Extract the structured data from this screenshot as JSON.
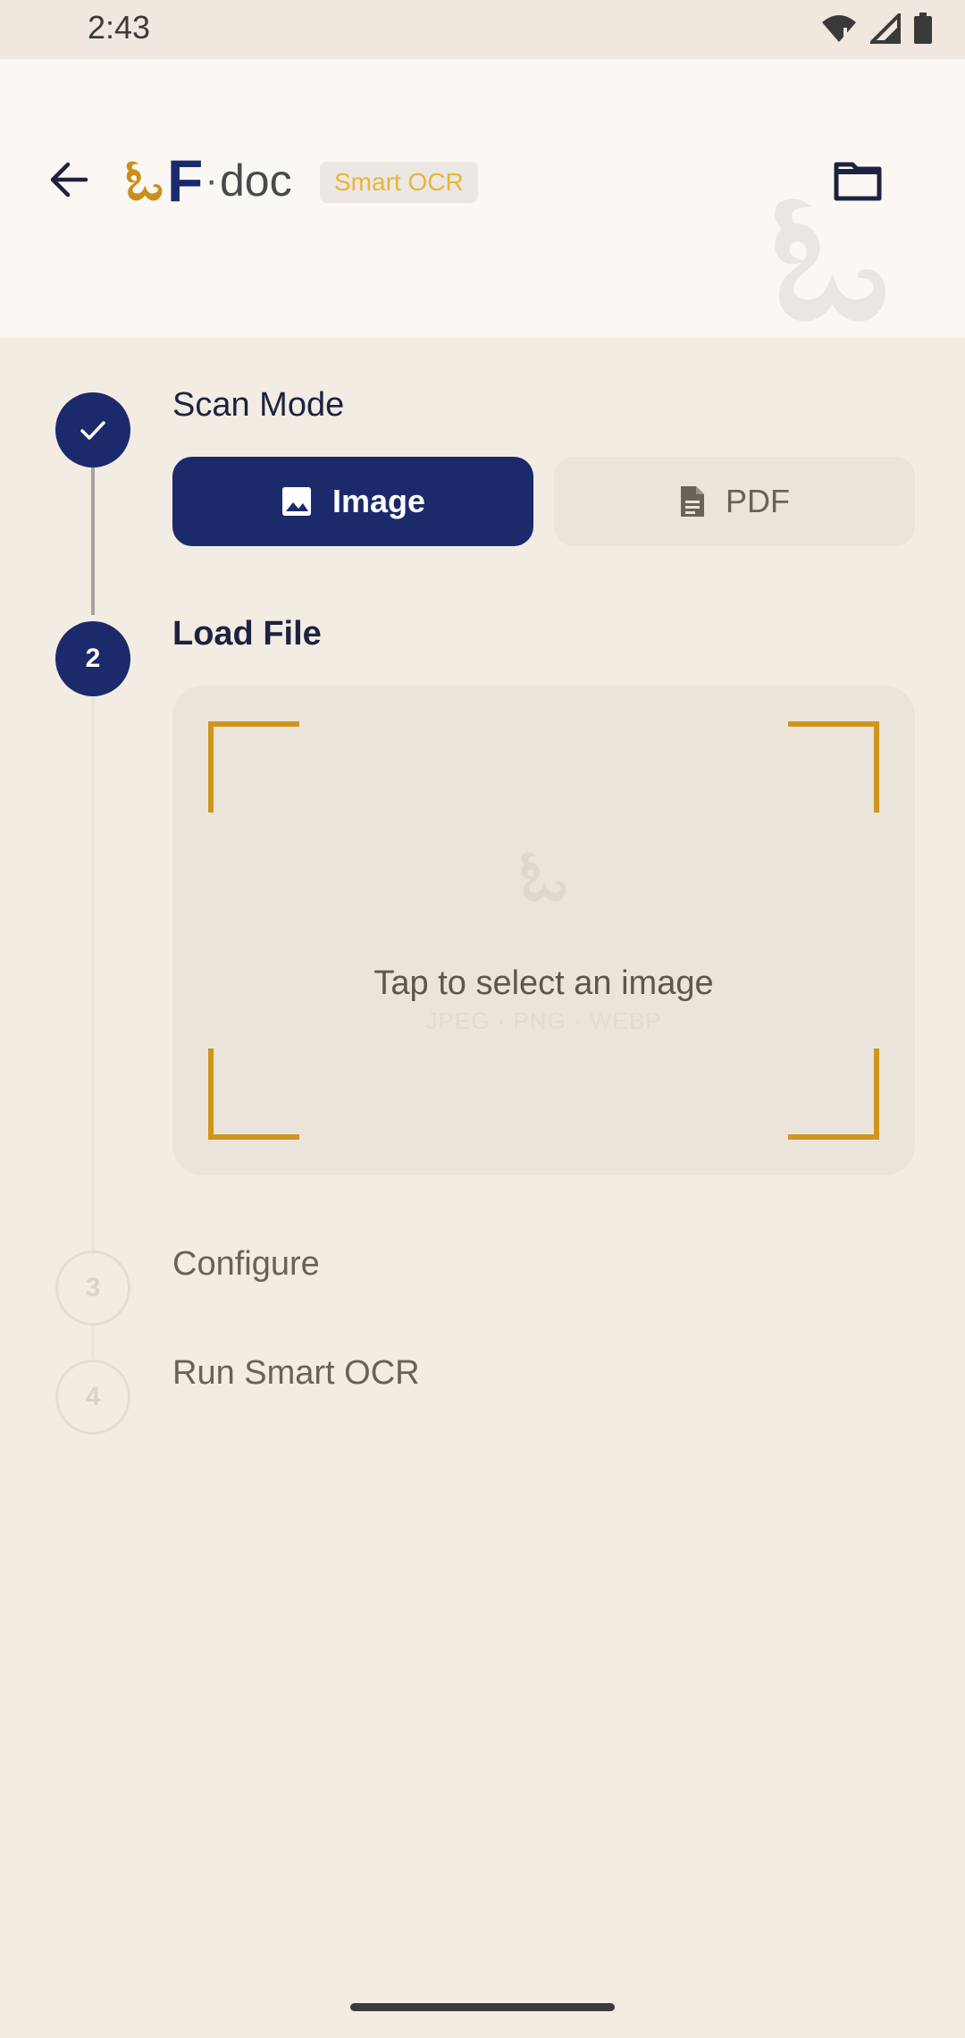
{
  "status_bar": {
    "time": "2:43",
    "icons": [
      "wifi-icon",
      "signal-icon",
      "battery-icon"
    ]
  },
  "header": {
    "logo": {
      "script": "ಓ",
      "letter": "F",
      "dot": "·",
      "word": "doc"
    },
    "badge": "Smart OCR",
    "watermark_glyph": "ಓ",
    "icons": {
      "back": "arrow-left-icon",
      "folder": "folder-icon"
    }
  },
  "steps": [
    {
      "number": "",
      "title": "Scan Mode",
      "state": "done"
    },
    {
      "number": "2",
      "title": "Load File",
      "state": "active"
    },
    {
      "number": "3",
      "title": "Configure",
      "state": "idle"
    },
    {
      "number": "4",
      "title": "Run Smart OCR",
      "state": "idle"
    }
  ],
  "scan_mode": {
    "image_label": "Image",
    "pdf_label": "PDF",
    "selected": "Image"
  },
  "dropzone": {
    "glyph": "ಓ",
    "prompt": "Tap to select an image",
    "formats": "JPEG · PNG · WEBP"
  },
  "colors": {
    "primary": "#1b2a6b",
    "accent": "#cf951e",
    "background": "#f3ece3"
  }
}
